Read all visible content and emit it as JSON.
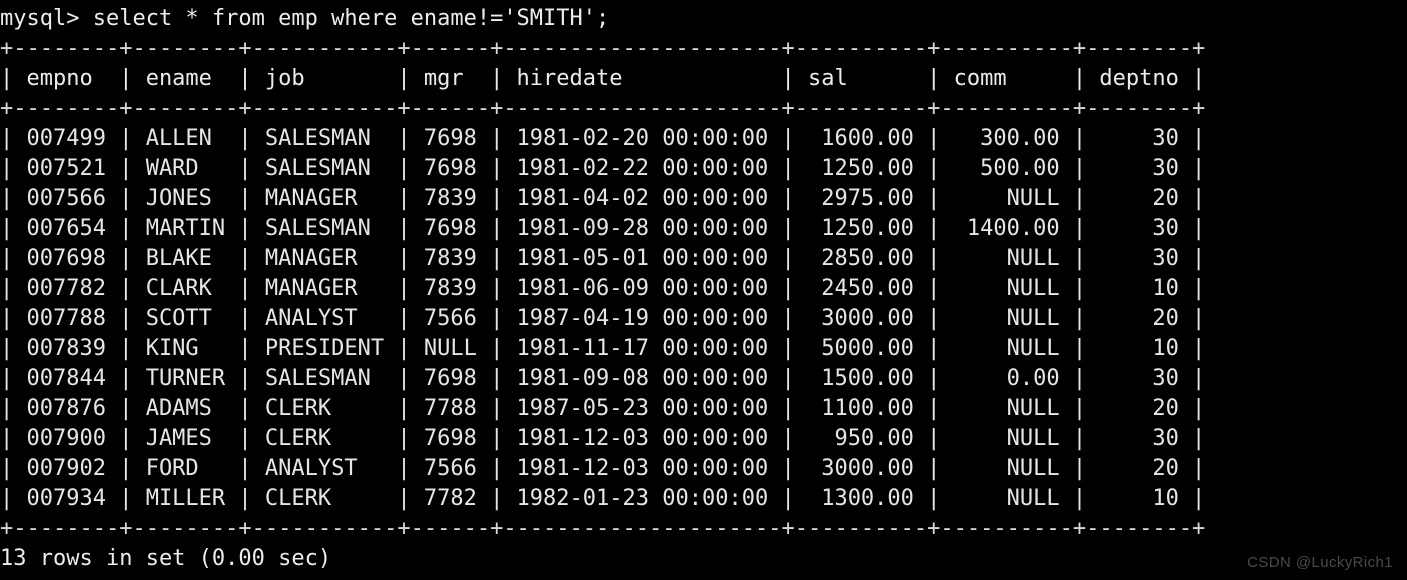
{
  "terminal": {
    "background_color": "#000000",
    "text_color": "#e6e6e6",
    "watermark": "CSDN @LuckyRich1"
  },
  "prompt": {
    "prefix": "mysql> ",
    "command": "select * from emp where ename!='SMITH';",
    "full_line": "mysql> select * from emp where ename!='SMITH';"
  },
  "result": {
    "columns": [
      {
        "name": "empno",
        "width": 8,
        "align": "right"
      },
      {
        "name": "ename",
        "width": 8,
        "align": "left"
      },
      {
        "name": "job",
        "width": 11,
        "align": "left"
      },
      {
        "name": "mgr",
        "width": 6,
        "align": "right"
      },
      {
        "name": "hiredate",
        "width": 21,
        "align": "left"
      },
      {
        "name": "sal",
        "width": 10,
        "align": "right"
      },
      {
        "name": "comm",
        "width": 10,
        "align": "right"
      },
      {
        "name": "deptno",
        "width": 8,
        "align": "right"
      }
    ],
    "rows": [
      [
        "007499",
        "ALLEN",
        "SALESMAN",
        "7698",
        "1981-02-20 00:00:00",
        "1600.00",
        "300.00",
        "30"
      ],
      [
        "007521",
        "WARD",
        "SALESMAN",
        "7698",
        "1981-02-22 00:00:00",
        "1250.00",
        "500.00",
        "30"
      ],
      [
        "007566",
        "JONES",
        "MANAGER",
        "7839",
        "1981-04-02 00:00:00",
        "2975.00",
        "NULL",
        "20"
      ],
      [
        "007654",
        "MARTIN",
        "SALESMAN",
        "7698",
        "1981-09-28 00:00:00",
        "1250.00",
        "1400.00",
        "30"
      ],
      [
        "007698",
        "BLAKE",
        "MANAGER",
        "7839",
        "1981-05-01 00:00:00",
        "2850.00",
        "NULL",
        "30"
      ],
      [
        "007782",
        "CLARK",
        "MANAGER",
        "7839",
        "1981-06-09 00:00:00",
        "2450.00",
        "NULL",
        "10"
      ],
      [
        "007788",
        "SCOTT",
        "ANALYST",
        "7566",
        "1987-04-19 00:00:00",
        "3000.00",
        "NULL",
        "20"
      ],
      [
        "007839",
        "KING",
        "PRESIDENT",
        "NULL",
        "1981-11-17 00:00:00",
        "5000.00",
        "NULL",
        "10"
      ],
      [
        "007844",
        "TURNER",
        "SALESMAN",
        "7698",
        "1981-09-08 00:00:00",
        "1500.00",
        "0.00",
        "30"
      ],
      [
        "007876",
        "ADAMS",
        "CLERK",
        "7788",
        "1987-05-23 00:00:00",
        "1100.00",
        "NULL",
        "20"
      ],
      [
        "007900",
        "JAMES",
        "CLERK",
        "7698",
        "1981-12-03 00:00:00",
        "950.00",
        "NULL",
        "30"
      ],
      [
        "007902",
        "FORD",
        "ANALYST",
        "7566",
        "1981-12-03 00:00:00",
        "3000.00",
        "NULL",
        "20"
      ],
      [
        "007934",
        "MILLER",
        "CLERK",
        "7782",
        "1982-01-23 00:00:00",
        "1300.00",
        "NULL",
        "10"
      ]
    ],
    "row_count": 13,
    "elapsed_seconds": "0.00",
    "status": "13 rows in set (0.00 sec)"
  }
}
